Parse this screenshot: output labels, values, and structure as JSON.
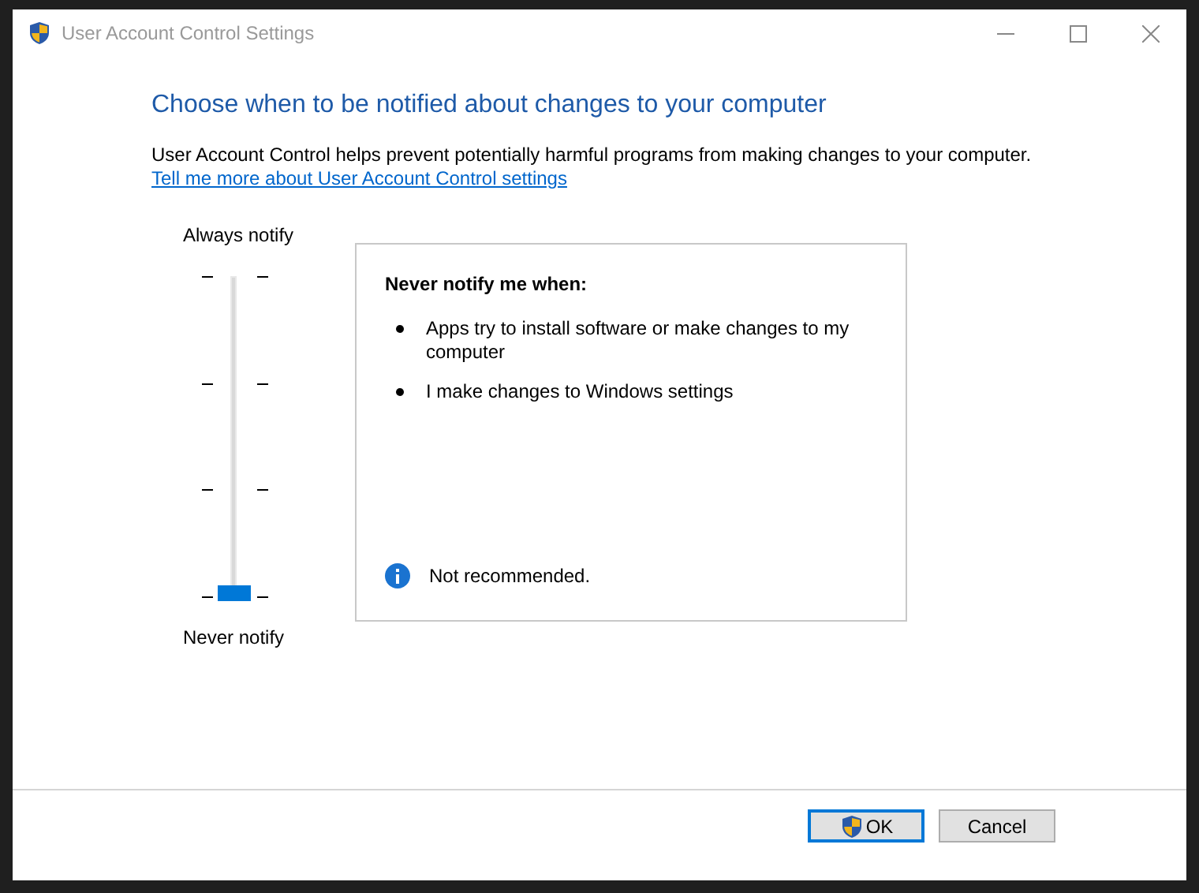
{
  "window": {
    "title": "User Account Control Settings"
  },
  "heading": "Choose when to be notified about changes to your computer",
  "description": "User Account Control helps prevent potentially harmful programs from making changes to your computer.",
  "link": "Tell me more about User Account Control settings",
  "slider": {
    "top_label": "Always notify",
    "bottom_label": "Never notify",
    "level": 0
  },
  "panel": {
    "title": "Never notify me when:",
    "items": [
      "Apps try to install software or make changes to my computer",
      "I make changes to Windows settings"
    ],
    "note": "Not recommended."
  },
  "buttons": [
    {
      "label": "OK",
      "default": true,
      "shield": true
    },
    {
      "label": "Cancel",
      "default": false,
      "shield": false
    }
  ]
}
